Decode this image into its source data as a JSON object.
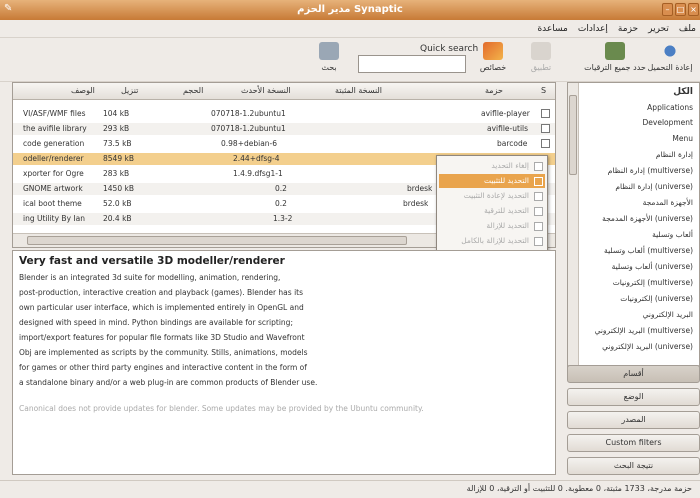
{
  "window": {
    "title": "مدير الحزم Synaptic"
  },
  "menu": [
    "ملف",
    "تحرير",
    "حزمة",
    "إعدادات",
    "مساعدة"
  ],
  "toolbar": {
    "reload": "إعادة التحميل",
    "mark_all_upgrades": "حدد جميع الترقيات",
    "apply": "تطبيق",
    "properties": "خصائص",
    "search": "بحث",
    "quick_search_label": "Quick search",
    "quick_search_value": ""
  },
  "table": {
    "headers": {
      "s": "S",
      "package": "حزمة",
      "installed": "النسخة المثبتة",
      "latest": "النسخة الأحدث",
      "size": "الحجم",
      "download": "تنزيل",
      "description": "الوصف"
    },
    "rows": [
      {
        "package": "aviflle-player",
        "installed": "",
        "latest": "070718-1.2ubuntu1",
        "size": "",
        "download": "104 kB",
        "description": "VI/ASF/WMF files"
      },
      {
        "package": "avifile-utils",
        "installed": "",
        "latest": "070718-1.2ubuntu1",
        "size": "",
        "download": "293 kB",
        "description": "the avifile library"
      },
      {
        "package": "barcode",
        "installed": "",
        "latest": "0.98+debian-6",
        "size": "",
        "download": "73.5 kB",
        "description": "code generation"
      },
      {
        "package": "",
        "installed": "",
        "latest": "2.44+dfsg-4",
        "size": "",
        "download": "8549 kB",
        "description": "odeller/renderer"
      },
      {
        "package": "",
        "installed": "",
        "latest": "1.4.9.dfsg1-1",
        "size": "",
        "download": "283 kB",
        "description": "xporter for Ogre"
      },
      {
        "package": "brdesk",
        "installed": "",
        "latest": "0.2",
        "size": "",
        "download": "1450 kB",
        "description": "GNOME artwork"
      },
      {
        "package": "brdesk",
        "installed": "",
        "latest": "0.2",
        "size": "",
        "download": "52.0 kB",
        "description": "ical boot theme"
      },
      {
        "package": "",
        "installed": "",
        "latest": "1.3-2",
        "size": "",
        "download": "20.4 kB",
        "description": "ing Utility By Ian"
      }
    ]
  },
  "context_menu": [
    {
      "label": "إلغاء التحديد",
      "enabled": false
    },
    {
      "label": "التحديد للتثبيت",
      "enabled": true
    },
    {
      "label": "التحديد لإعادة التثبيت",
      "enabled": false
    },
    {
      "label": "التحديد للترقية",
      "enabled": false
    },
    {
      "label": "التحديد للإزالة",
      "enabled": false
    },
    {
      "label": "التحديد للإزالة بالكامل",
      "enabled": false
    }
  ],
  "description": {
    "title": "Very fast and versatile 3D modeller/renderer",
    "lines": [
      "Blender is an integrated 3d suite for modelling, animation, rendering,",
      "post-production, interactive creation and playback (games). Blender has its",
      "own particular user interface, which is implemented entirely in OpenGL and",
      "designed with speed in mind. Python bindings are available for scripting;",
      "import/export features for popular file formats like 3D Studio and Wavefront",
      "Obj are implemented as scripts by the community. Stills, animations, models",
      "for games or other third party engines and interactive content in the form of",
      "a standalone binary and/or a web plug-in are common products of Blender use."
    ],
    "note": "Canonical does not provide updates for blender. Some updates may be provided by the Ubuntu community."
  },
  "sidebar": {
    "items": [
      "الكل",
      "Applications",
      "Development",
      "Menu",
      "إدارة النظام",
      "إدارة النظام (multiverse)",
      "إدارة النظام (universe)",
      "الأجهزة المدمجة",
      "الأجهزة المدمجة (universe)",
      "ألعاب وتسلية",
      "ألعاب وتسلية (multiverse)",
      "ألعاب وتسلية (universe)",
      "إلكترونيات (multiverse)",
      "إلكترونيات (universe)",
      "البريد الإلكتروني",
      "البريد الإلكتروني (multiverse)",
      "البريد الإلكتروني (universe)"
    ]
  },
  "filters": {
    "sections": "أقسام",
    "status": "الوضع",
    "origin": "المصدر",
    "custom": "Custom filters",
    "search_results": "نتيجة البحث"
  },
  "status": {
    "text": "حزمة مدرجة، 1733 مثبتة، 0 معطوبة. 0 للتثبيت أو الترقية، 0 للإزالة"
  }
}
